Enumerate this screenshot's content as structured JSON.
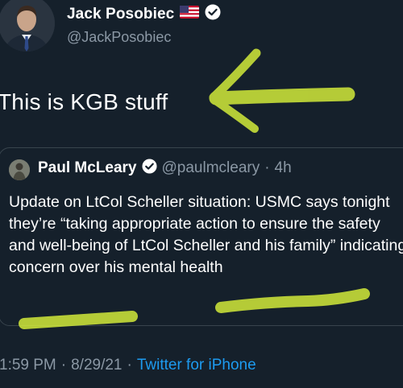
{
  "author": {
    "name": "Jack Posobiec",
    "handle": "@JackPosobiec",
    "flag_icon": "us-flag-icon",
    "verified_icon": "verified-badge-icon"
  },
  "tweet": {
    "text": "This is KGB stuff"
  },
  "quoted": {
    "name": "Paul McLeary",
    "handle": "@paulmcleary",
    "separator": "·",
    "time": "4h",
    "body": "Update on LtCol Scheller situation: USMC says tonight they’re “taking appropriate action to ensure the safety and well-being of LtCol Scheller and his family” indicating concern over his mental health"
  },
  "meta": {
    "time": "1:59 PM",
    "sep1": "·",
    "date": "8/29/21",
    "sep2": "·",
    "source": "Twitter for iPhone"
  },
  "colors": {
    "background": "#15202b",
    "link": "#1d9bf0",
    "secondary_text": "#8b98a5",
    "highlighter": "#d9f23a"
  }
}
